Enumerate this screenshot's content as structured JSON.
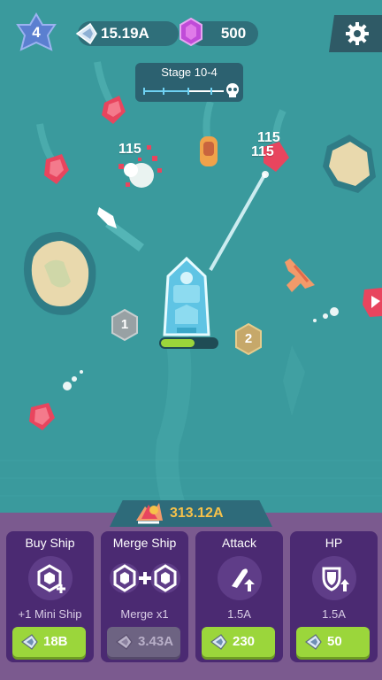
{
  "hud": {
    "level": "4",
    "gems": "15.19A",
    "crystals": "500"
  },
  "stage": {
    "label": "Stage 10-4",
    "progress": 0.55
  },
  "battle": {
    "damage_numbers": [
      "115",
      "115",
      "115"
    ],
    "slot_1": "1",
    "slot_2": "2",
    "player_hp": 0.6
  },
  "coins": "313.12A",
  "cards": {
    "buy_ship": {
      "title": "Buy Ship",
      "subtitle": "+1 Mini Ship",
      "cost": "18B"
    },
    "merge_ship": {
      "title": "Merge Ship",
      "subtitle": "Merge x1",
      "cost": "3.43A"
    },
    "attack": {
      "title": "Attack",
      "subtitle": "1.5A",
      "cost": "230"
    },
    "hp": {
      "title": "HP",
      "subtitle": "1.5A",
      "cost": "50"
    }
  },
  "colors": {
    "sea": "#3a9a9d",
    "panel": "#7b5a8f",
    "card": "#4b2a72",
    "button_green": "#9bd63b",
    "coin_gold": "#f6c24a",
    "enemy_red": "#e8455e"
  },
  "icons": [
    "star-icon",
    "diamond-gem-icon",
    "crystal-icon",
    "gear-icon",
    "skull-icon",
    "plus-icon",
    "bullet-icon",
    "shield-icon",
    "coins-icon"
  ]
}
